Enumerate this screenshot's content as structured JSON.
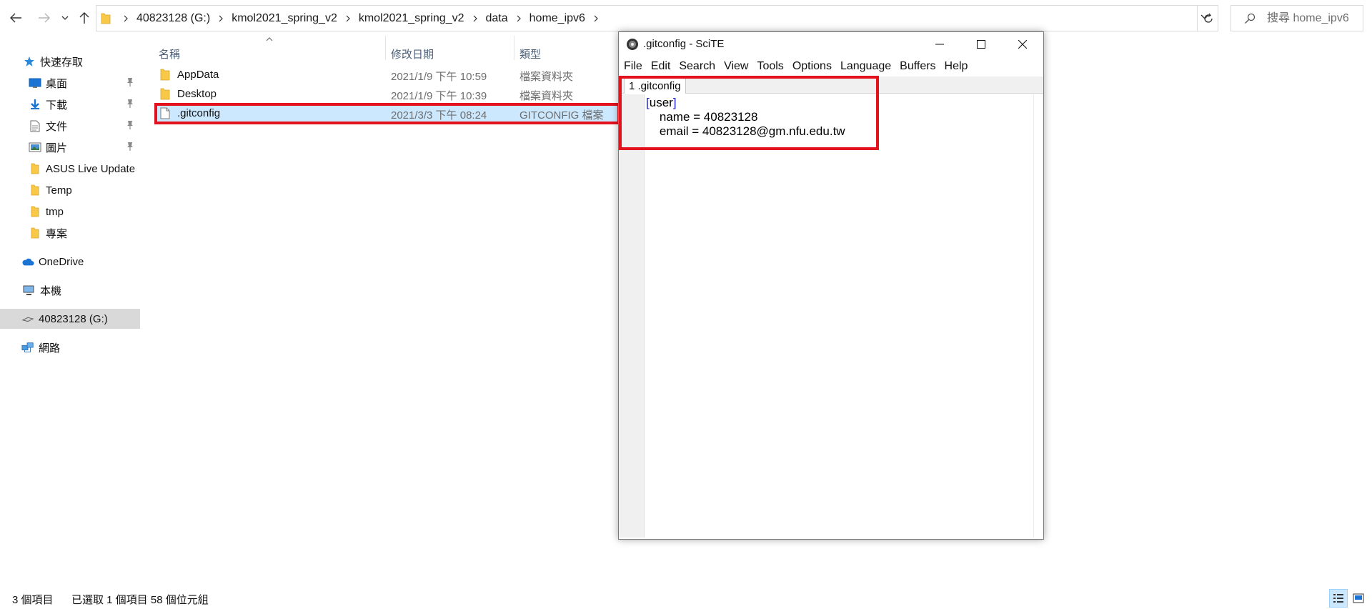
{
  "explorer": {
    "nav_buttons": [
      "back-icon",
      "forward-icon",
      "recent-dropdown-icon",
      "up-icon"
    ],
    "breadcrumbs": [
      "40823128 (G:)",
      "kmol2021_spring_v2",
      "kmol2021_spring_v2",
      "data",
      "home_ipv6"
    ],
    "search_placeholder": "搜尋 home_ipv6",
    "sidebar": {
      "quick_access": "快速存取",
      "items": [
        {
          "label": "桌面",
          "icon": "desktop-icon",
          "pinned": true
        },
        {
          "label": "下載",
          "icon": "download-icon",
          "pinned": true
        },
        {
          "label": "文件",
          "icon": "documents-icon",
          "pinned": true
        },
        {
          "label": "圖片",
          "icon": "pictures-icon",
          "pinned": true
        },
        {
          "label": "ASUS Live Update",
          "icon": "folder-icon",
          "pinned": false
        },
        {
          "label": "Temp",
          "icon": "folder-icon",
          "pinned": false
        },
        {
          "label": "tmp",
          "icon": "folder-icon",
          "pinned": false
        },
        {
          "label": "專案",
          "icon": "folder-icon",
          "pinned": false
        }
      ],
      "onedrive": "OneDrive",
      "this_pc": "本機",
      "drive": "40823128 (G:)",
      "network": "網路"
    },
    "columns": {
      "name": "名稱",
      "date": "修改日期",
      "type": "類型"
    },
    "files": [
      {
        "name": "AppData",
        "date": "2021/1/9 下午 10:59",
        "type": "檔案資料夾",
        "icon": "folder-icon"
      },
      {
        "name": "Desktop",
        "date": "2021/1/9 下午 10:39",
        "type": "檔案資料夾",
        "icon": "folder-icon"
      },
      {
        "name": ".gitconfig",
        "date": "2021/3/3 下午 08:24",
        "type": "GITCONFIG 檔案",
        "icon": "file-icon"
      }
    ],
    "status": {
      "items": "3 個項目",
      "selected": "已選取 1 個項目  58 個位元組"
    }
  },
  "scite": {
    "title": ".gitconfig - SciTE",
    "menu": [
      "File",
      "Edit",
      "Search",
      "View",
      "Tools",
      "Options",
      "Language",
      "Buffers",
      "Help"
    ],
    "tab": "1 .gitconfig",
    "code": {
      "open_bracket": "[",
      "section": "user",
      "close_bracket": "]",
      "line2": "    name = 40823128",
      "line3": "    email = 40823128@gm.nfu.edu.tw"
    }
  },
  "colors": {
    "highlight": "#e3121c",
    "selection": "#cce8ff",
    "folder": "#f8c849"
  }
}
